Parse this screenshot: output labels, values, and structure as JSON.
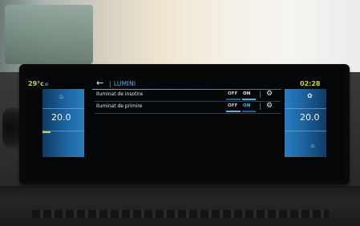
{
  "status_bar": {
    "temperature": "29°c",
    "time": "02:28"
  },
  "header": {
    "back_icon": "back-arrow-icon",
    "separator": "|",
    "title": "LUMINI"
  },
  "climate": {
    "left_temp": "20.0",
    "right_temp": "20.0"
  },
  "settings": [
    {
      "label": "Iluminat de insotire",
      "off_label": "OFF",
      "on_label": "ON",
      "state": "ON"
    },
    {
      "label": "Iluminat de primire",
      "off_label": "OFF",
      "on_label": "ON",
      "state": "OFF"
    }
  ],
  "colors": {
    "accent_blue": "#4fb2ee",
    "status_yellow": "#c8d63a",
    "panel_blue": "#1e66a3"
  }
}
